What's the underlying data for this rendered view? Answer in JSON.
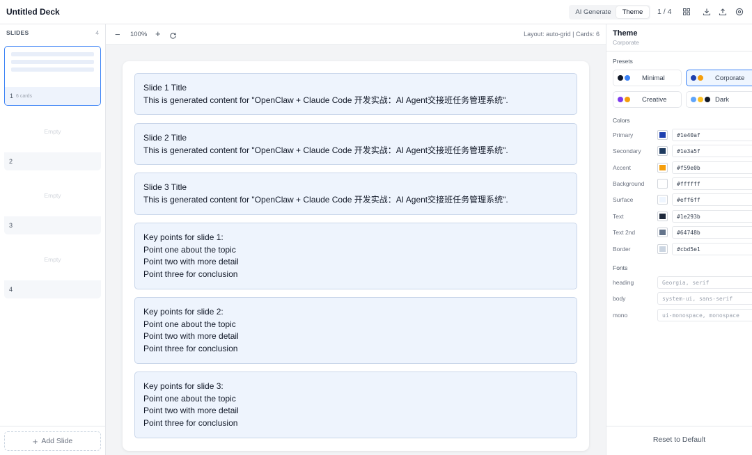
{
  "app": {
    "title": "Untitled Deck"
  },
  "toolbar": {
    "ai_generate_label": "AI Generate",
    "theme_label": "Theme",
    "page_indicator": "1 / 4",
    "icons": [
      "grid-view-icon",
      "download-icon",
      "upload-icon",
      "settings-icon"
    ]
  },
  "slides_panel": {
    "heading": "SLIDES",
    "count": "4",
    "slides": [
      {
        "number": "1",
        "cards": "6 cards",
        "empty": ""
      },
      {
        "number": "2",
        "cards": "",
        "empty": "Empty"
      },
      {
        "number": "3",
        "cards": "",
        "empty": "Empty"
      },
      {
        "number": "4",
        "cards": "",
        "empty": "Empty"
      }
    ],
    "add_slide_label": "Add Slide"
  },
  "canvas": {
    "zoom": "100%",
    "layout_info": "Layout: auto-grid | Cards: 6",
    "cards": [
      {
        "lines": [
          "Slide 1 Title",
          "This is generated content for \"OpenClaw + Claude Code 开发实战：AI Agent交接班任务管理系统\"."
        ]
      },
      {
        "lines": [
          "Slide 2 Title",
          "This is generated content for \"OpenClaw + Claude Code 开发实战：AI Agent交接班任务管理系统\"."
        ]
      },
      {
        "lines": [
          "Slide 3 Title",
          "This is generated content for \"OpenClaw + Claude Code 开发实战：AI Agent交接班任务管理系统\"."
        ]
      },
      {
        "lines": [
          "Key points for slide 1:",
          "Point one about the topic",
          "Point two with more detail",
          "Point three for conclusion"
        ]
      },
      {
        "lines": [
          "Key points for slide 2:",
          "Point one about the topic",
          "Point two with more detail",
          "Point three for conclusion"
        ]
      },
      {
        "lines": [
          "Key points for slide 3:",
          "Point one about the topic",
          "Point two with more detail",
          "Point three for conclusion"
        ]
      }
    ]
  },
  "theme_panel": {
    "title": "Theme",
    "current": "Corporate",
    "presets_label": "Presets",
    "presets": [
      {
        "name": "Minimal",
        "dots": [
          "#111827",
          "#3b82f6"
        ]
      },
      {
        "name": "Corporate",
        "dots": [
          "#1e40af",
          "#f59e0b"
        ]
      },
      {
        "name": "Creative",
        "dots": [
          "#7c3aed",
          "#f59e0b"
        ]
      },
      {
        "name": "Dark",
        "dots": [
          "#60a5fa",
          "#fbbf24",
          "#111827"
        ]
      }
    ],
    "colors_label": "Colors",
    "colors": [
      {
        "label": "Primary",
        "value": "#1e40af"
      },
      {
        "label": "Secondary",
        "value": "#1e3a5f"
      },
      {
        "label": "Accent",
        "value": "#f59e0b"
      },
      {
        "label": "Background",
        "value": "#ffffff"
      },
      {
        "label": "Surface",
        "value": "#eff6ff"
      },
      {
        "label": "Text",
        "value": "#1e293b"
      },
      {
        "label": "Text 2nd",
        "value": "#64748b"
      },
      {
        "label": "Border",
        "value": "#cbd5e1"
      }
    ],
    "fonts_label": "Fonts",
    "fonts": [
      {
        "label": "heading",
        "placeholder": "Georgia, serif"
      },
      {
        "label": "body",
        "placeholder": "system-ui, sans-serif"
      },
      {
        "label": "mono",
        "placeholder": "ui-monospace, monospace"
      }
    ],
    "reset_label": "Reset to Default"
  }
}
